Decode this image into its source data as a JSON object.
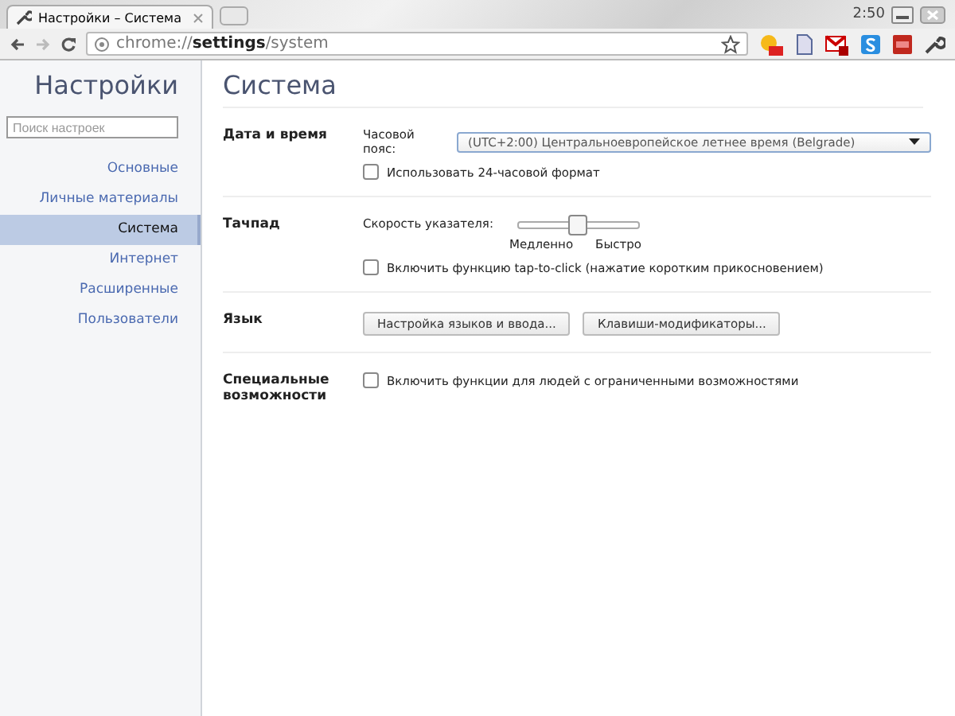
{
  "window": {
    "tab_title": "Настройки – Система",
    "clock": "2:50"
  },
  "toolbar": {
    "url": "chrome://**settings**/system"
  },
  "sidebar": {
    "title": "Настройки",
    "search": {
      "placeholder": "Поиск настроек"
    },
    "items": [
      {
        "label": "Основные",
        "selected": false
      },
      {
        "label": "Личные материалы",
        "selected": false
      },
      {
        "label": "Система",
        "selected": true
      },
      {
        "label": "Интернет",
        "selected": false
      },
      {
        "label": "Расширенные",
        "selected": false
      },
      {
        "label": "Пользователи",
        "selected": false
      }
    ]
  },
  "page": {
    "title": "Система",
    "sections": [
      {
        "title": "Дата и время",
        "rows": [
          {
            "kind": "select",
            "label": "Часовой пояс:",
            "value": "(UTC+2:00) Центральноевропейское летнее время (Belgrade)"
          },
          {
            "kind": "checkbox",
            "label": "Использовать 24-часовой формат",
            "checked": false
          }
        ]
      },
      {
        "title": "Тачпад",
        "rows": [
          {
            "kind": "slider",
            "label": "Скорость указателя:",
            "level": 0.5,
            "min_label": "Медленно",
            "max_label": "Быстро"
          },
          {
            "kind": "checkbox",
            "label": "Включить функцию tap-to-click (нажатие коротким прикосновением)",
            "checked": false
          }
        ]
      },
      {
        "title": "Язык",
        "rows": [
          {
            "kind": "buttons",
            "buttons": [
              "Настройка языков и ввода...",
              "Клавиши-модификаторы..."
            ]
          }
        ]
      },
      {
        "title": "Специальные возможности",
        "rows": [
          {
            "kind": "checkbox",
            "label": "Включить функции для людей с ограниченными возможностями",
            "checked": false
          }
        ]
      }
    ]
  }
}
